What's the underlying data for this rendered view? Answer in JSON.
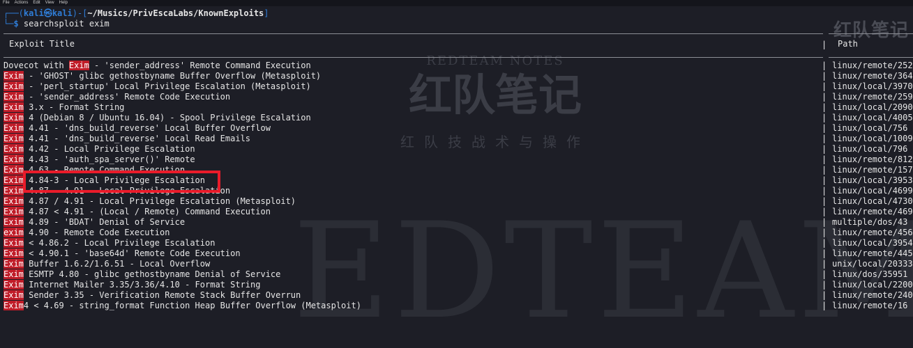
{
  "menubar": {
    "items": [
      "File",
      "Actions",
      "Edit",
      "View",
      "Help"
    ]
  },
  "prompt": {
    "line1_prefix": "┌──(",
    "user": "kali",
    "at": "㉿",
    "host": "kali",
    "mid": ")-[",
    "path": "~/Musics/PrivEscaLabs/KnownExploits",
    "end": "]",
    "line2_prefix": "└─",
    "dollar": "$",
    "command": "searchsploit",
    "argument": "exim"
  },
  "table": {
    "header_title": "Exploit Title",
    "header_path": "Path",
    "separator": "|",
    "rows": [
      {
        "pre": "Dovecot with ",
        "hl": "Exim",
        "post": " - 'sender_address' Remote Command Execution",
        "path": "linux/remote/252"
      },
      {
        "pre": "",
        "hl": "Exim",
        "post": " - 'GHOST' glibc gethostbyname Buffer Overflow (Metasploit)",
        "path": "linux/remote/364"
      },
      {
        "pre": "",
        "hl": "Exim",
        "post": " - 'perl_startup' Local Privilege Escalation (Metasploit)",
        "path": "linux/local/3970"
      },
      {
        "pre": "",
        "hl": "Exim",
        "post": " - 'sender_address' Remote Code Execution",
        "path": "linux/remote/259"
      },
      {
        "pre": "",
        "hl": "Exim",
        "post": " 3.x - Format String",
        "path": "linux/local/2090"
      },
      {
        "pre": "",
        "hl": "Exim",
        "post": " 4 (Debian 8 / Ubuntu 16.04) - Spool Privilege Escalation",
        "path": "linux/local/4005"
      },
      {
        "pre": "",
        "hl": "Exim",
        "post": " 4.41 - 'dns_build_reverse' Local Buffer Overflow",
        "path": "linux/local/756"
      },
      {
        "pre": "",
        "hl": "Exim",
        "post": " 4.41 - 'dns_build_reverse' Local Read Emails",
        "path": "linux/local/1009"
      },
      {
        "pre": "",
        "hl": "Exim",
        "post": " 4.42 - Local Privilege Escalation",
        "path": "linux/local/796"
      },
      {
        "pre": "",
        "hl": "Exim",
        "post": " 4.43 - 'auth_spa_server()' Remote",
        "path": "linux/remote/812"
      },
      {
        "pre": "",
        "hl": "Exim",
        "post": " 4.63 - Remote Command Execution",
        "path": "linux/remote/157"
      },
      {
        "pre": "",
        "hl": "Exim",
        "post": " 4.84-3 - Local Privilege Escalation",
        "path": "linux/local/3953"
      },
      {
        "pre": "",
        "hl": "Exim",
        "post": " 4.87 - 4.91 - Local Privilege Escalation",
        "path": "linux/local/4699"
      },
      {
        "pre": "",
        "hl": "Exim",
        "post": " 4.87 / 4.91 - Local Privilege Escalation (Metasploit)",
        "path": "linux/local/4730"
      },
      {
        "pre": "",
        "hl": "Exim",
        "post": " 4.87 < 4.91 - (Local / Remote) Command Execution",
        "path": "linux/remote/469"
      },
      {
        "pre": "",
        "hl": "Exim",
        "post": " 4.89 - 'BDAT' Denial of Service",
        "path": "multiple/dos/43"
      },
      {
        "pre": "",
        "hl": "exim",
        "post": " 4.90 - Remote Code Execution",
        "path": "linux/remote/456"
      },
      {
        "pre": "",
        "hl": "Exim",
        "post": " < 4.86.2 - Local Privilege Escalation",
        "path": "linux/local/3954"
      },
      {
        "pre": "",
        "hl": "Exim",
        "post": " < 4.90.1 - 'base64d' Remote Code Execution",
        "path": "linux/remote/445"
      },
      {
        "pre": "",
        "hl": "Exim",
        "post": " Buffer 1.6.2/1.6.51 - Local Overflow",
        "path": "unix/local/20333"
      },
      {
        "pre": "",
        "hl": "Exim",
        "post": " ESMTP 4.80 - glibc gethostbyname Denial of Service",
        "path": "linux/dos/35951"
      },
      {
        "pre": "",
        "hl": "Exim",
        "post": " Internet Mailer 3.35/3.36/4.10 - Format String",
        "path": "linux/local/2200"
      },
      {
        "pre": "",
        "hl": "Exim",
        "post": " Sender 3.35 - Verification Remote Stack Buffer Overrun",
        "path": "linux/remote/240"
      },
      {
        "pre": "",
        "hl": "Exim",
        "post": "4 < 4.69 - string_format Function Heap Buffer Overflow (Metasploit)",
        "path": "linux/remote/16"
      }
    ]
  },
  "watermark": {
    "top_right": "红队笔记",
    "center_en": "REDTEAM NOTES",
    "center_cn": "红队笔记",
    "center_sub": "红队技战术与操作",
    "big": "EDTEAM"
  },
  "colors": {
    "background": "#1d1e26",
    "prompt_blue": "#2f7dd7",
    "highlight_red": "#c01c28",
    "annotation_box": "#ea1b2a"
  }
}
